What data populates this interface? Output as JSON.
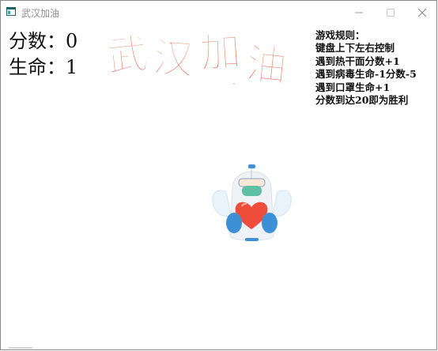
{
  "window": {
    "title": "武汉加油"
  },
  "scoreboard": {
    "score_label": "分数：",
    "score_value": "0",
    "lives_label": "生命：",
    "lives_value": "1"
  },
  "banner": {
    "text": "武汉加油",
    "color_top": "#f7a078",
    "color_bottom": "#e6504a"
  },
  "rules": {
    "lines": [
      "游戏规则：",
      "键盘上下左右控制",
      "遇到热干面分数+1",
      "遇到病毒生命-1分数-5",
      "遇到口罩生命+1",
      "分数到达20即为胜利"
    ]
  },
  "player": {
    "icon": "medic-angel-holding-heart-icon",
    "suit_color": "#eef2f7",
    "mask_color": "#5fbfa3",
    "heart_color": "#ee4d3b",
    "glove_color": "#3d8fd6"
  }
}
